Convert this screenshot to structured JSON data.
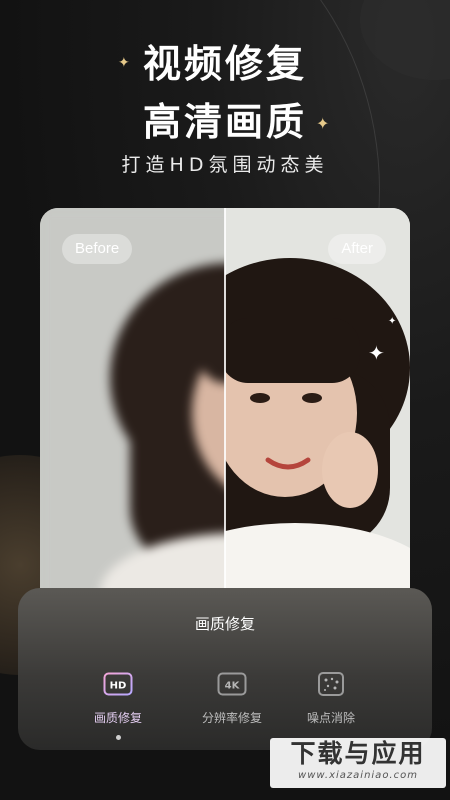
{
  "hero": {
    "title_line1": "视频修复",
    "title_line2": "高清画质",
    "subtitle": "打造HD氛围动态美"
  },
  "comparison": {
    "before_label": "Before",
    "after_label": "After"
  },
  "panel": {
    "title": "画质修复",
    "tools": [
      {
        "icon": "hd-icon",
        "label": "画质修复",
        "selected": true
      },
      {
        "icon": "4k-icon",
        "label": "分辨率修复",
        "selected": false
      },
      {
        "icon": "noise-icon",
        "label": "噪点消除",
        "selected": false
      }
    ],
    "hd_badge": "HD",
    "k4_badge": "4K"
  },
  "watermark": {
    "main": "下载与应用",
    "url": "www.xiazainiao.com"
  },
  "colors": {
    "background": "#141414",
    "accent_sparkle": "#e6c98a",
    "selected_tool": "#e3cdf0"
  }
}
